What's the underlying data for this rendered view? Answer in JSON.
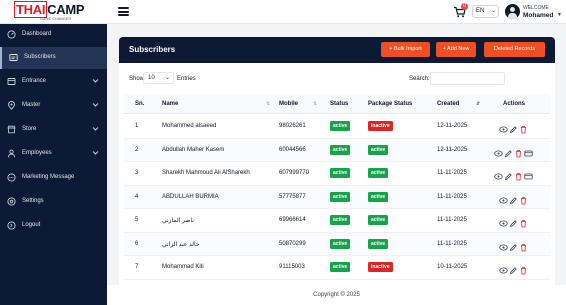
{
  "header": {
    "logo_part1": "THAI",
    "logo_part2": "CAMP",
    "logo_sub": "GAME CHANGER",
    "cart_count": "0",
    "language": "EN",
    "welcome": "WELCOME",
    "user_name": "Mohamed"
  },
  "sidebar": {
    "items": [
      {
        "label": "Dashboard",
        "icon": "dashboard-icon",
        "active": false,
        "has_arrow": false
      },
      {
        "label": "Subscribers",
        "icon": "subscribers-icon",
        "active": true,
        "has_arrow": false
      },
      {
        "label": "Entrance",
        "icon": "entrance-icon",
        "active": false,
        "has_arrow": true
      },
      {
        "label": "Master",
        "icon": "map-pin-icon",
        "active": false,
        "has_arrow": true
      },
      {
        "label": "Store",
        "icon": "store-icon",
        "active": false,
        "has_arrow": true
      },
      {
        "label": "Employees",
        "icon": "employees-icon",
        "active": false,
        "has_arrow": true
      },
      {
        "label": "Marketing Message",
        "icon": "message-icon",
        "active": false,
        "has_arrow": false
      },
      {
        "label": "Settings",
        "icon": "gear-icon",
        "active": false,
        "has_arrow": false
      },
      {
        "label": "Logout",
        "icon": "logout-icon",
        "active": false,
        "has_arrow": false
      }
    ]
  },
  "panel": {
    "title": "Subscribers",
    "buttons": {
      "bulk_import": "+ Bulk Import",
      "add_new": "+ Add New",
      "deleted_records": "Deleted Records"
    },
    "show_label": "Show",
    "show_value": "10",
    "entries_label": "Entries",
    "search_label": "Search:"
  },
  "table": {
    "headers": {
      "sn": "Sn.",
      "name": "Name",
      "mobile": "Mobile",
      "status": "Status",
      "package_status": "Package Status",
      "created": "Created",
      "actions": "Actions"
    },
    "rows": [
      {
        "sn": "1",
        "name": "Mohammed alsaeed",
        "mobile": "98026261",
        "status": "active",
        "package_status": "inactive",
        "created": "12-11-2025",
        "actions": 3
      },
      {
        "sn": "2",
        "name": "Abdullah Maher Kasem",
        "mobile": "60044566",
        "status": "active",
        "package_status": "active",
        "created": "12-11-2025",
        "actions": 4
      },
      {
        "sn": "3",
        "name": "Sharekh Mahmoud Ali AlSharekh",
        "mobile": "607999770",
        "status": "active",
        "package_status": "active",
        "created": "11-11-2025",
        "actions": 4
      },
      {
        "sn": "4",
        "name": "ABDULLAH BURMIA",
        "mobile": "57775877",
        "status": "active",
        "package_status": "active",
        "created": "11-11-2025",
        "actions": 3
      },
      {
        "sn": "5",
        "name": "ناصر المازني",
        "mobile": "69966614",
        "status": "active",
        "package_status": "active",
        "created": "11-11-2025",
        "actions": 3
      },
      {
        "sn": "6",
        "name": "خالد عبد الزاني",
        "mobile": "50870299",
        "status": "active",
        "package_status": "active",
        "created": "11-11-2025",
        "actions": 3
      },
      {
        "sn": "7",
        "name": "Mohammad Kiti",
        "mobile": "91115003",
        "status": "active",
        "package_status": "inactive",
        "created": "10-11-2025",
        "actions": 3
      }
    ]
  },
  "footer": {
    "copyright": "Copyright © 2025"
  },
  "colors": {
    "sidebar_bg": "#0c1a35",
    "accent_button": "#f04e23",
    "badge_active": "#16a34a",
    "badge_inactive": "#dc2626",
    "brand_red": "#e11d2a"
  }
}
